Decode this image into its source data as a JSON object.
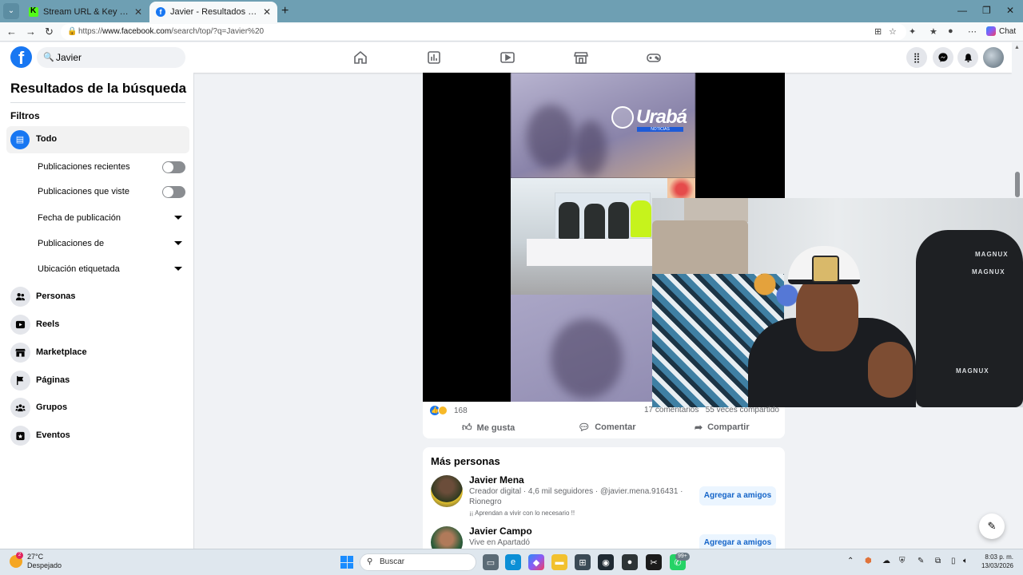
{
  "browser": {
    "tabs": [
      {
        "label": "Stream URL & Key - Kick Dashboard",
        "favicon": "kick-icon"
      },
      {
        "label": "Javier - Resultados de búsqueda | Facebook",
        "favicon": "facebook-icon"
      }
    ],
    "url_prefix": "https://",
    "url_host": "www.facebook.com",
    "url_path": "/search/top/?q=Javier%20",
    "chat_label": "Chat"
  },
  "fb": {
    "search_value": "Javier",
    "logo_letter": "f"
  },
  "sidebar": {
    "title": "Resultados de la búsqueda",
    "filters_label": "Filtros",
    "selected": "Todo",
    "sub_filters": [
      {
        "label": "Publicaciones recientes",
        "control": "toggle"
      },
      {
        "label": "Publicaciones que viste",
        "control": "toggle"
      },
      {
        "label": "Fecha de publicación",
        "control": "dropdown"
      },
      {
        "label": "Publicaciones de",
        "control": "dropdown"
      },
      {
        "label": "Ubicación etiquetada",
        "control": "dropdown"
      }
    ],
    "categories": [
      {
        "label": "Personas",
        "icon": "people-icon"
      },
      {
        "label": "Reels",
        "icon": "reels-icon"
      },
      {
        "label": "Marketplace",
        "icon": "marketplace-icon"
      },
      {
        "label": "Páginas",
        "icon": "flag-icon"
      },
      {
        "label": "Grupos",
        "icon": "groups-icon"
      },
      {
        "label": "Eventos",
        "icon": "calendar-icon"
      }
    ]
  },
  "post": {
    "watermark": "Urabá",
    "watermark_sub": "NOTICIAS",
    "reaction_count": "168",
    "comments": "17 comentarios",
    "shares": "55 veces compartido",
    "actions": [
      "Me gusta",
      "Comentar",
      "Compartir"
    ]
  },
  "webcam": {
    "chair_brand": "MAGNUX"
  },
  "more_people": {
    "title": "Más personas",
    "people": [
      {
        "name": "Javier Mena",
        "meta": "Creador digital · 4,6 mil seguidores · @javier.mena.916431 · Rionegro",
        "quote": "¡¡ Aprendan a vivir con lo necesario !!",
        "button": "Agregar a amigos"
      },
      {
        "name": "Javier Campo",
        "meta": "Vive en Apartadó",
        "button": "Agregar a amigos"
      }
    ]
  },
  "taskbar": {
    "temperature": "27°C",
    "weather": "Despejado",
    "weather_badge": "2",
    "search_placeholder": "Buscar",
    "whatsapp_badge": "99+",
    "time": "8:03 p. m.",
    "date": "13/03/2026"
  },
  "colors": {
    "fb_blue": "#1877f2",
    "tab_bar": "#6e9fb3",
    "page_bg": "#f0f2f5"
  }
}
